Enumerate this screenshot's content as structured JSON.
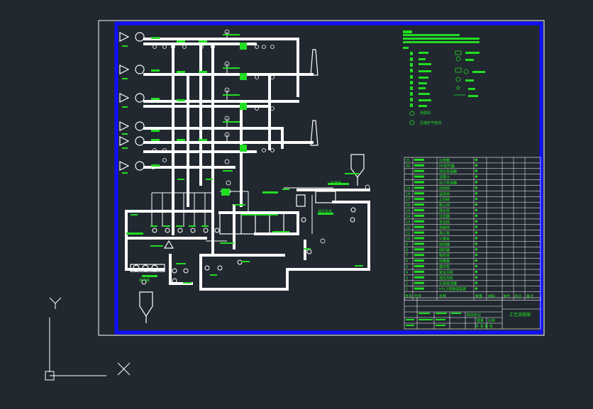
{
  "colors": {
    "background": "#212830",
    "sheet_border": "#ffffff",
    "frame": "#1010ff",
    "pipe": "#ffffff",
    "annotation": "#22dd22",
    "table_line": "#ffffff"
  },
  "icons": {
    "ucs_y_axis": "Y",
    "ucs_x_axis": "X"
  },
  "legend": {
    "item_a": "电源线",
    "item_b": "压缩空气管线"
  },
  "equipment_labels": {
    "silo": "除雾器",
    "separator": "液压系统",
    "tank": "缓冲罐"
  },
  "parts_table": {
    "header": [
      "序号",
      "代号",
      "名称",
      "数量",
      "材料",
      "单件",
      "总计",
      "备注"
    ],
    "rows": [
      {
        "no": "21",
        "code": "",
        "name": "仪表箱"
      },
      {
        "no": "20",
        "code": "",
        "name": "PH调节器"
      },
      {
        "no": "",
        "code": "",
        "name": "液位变送器"
      },
      {
        "no": "",
        "code": "",
        "name": "流量计"
      },
      {
        "no": "",
        "code": "",
        "name": "压力变送器"
      },
      {
        "no": "19",
        "code": "",
        "name": "控制阀"
      },
      {
        "no": "18",
        "code": "",
        "name": "溢流阀"
      },
      {
        "no": "17",
        "code": "",
        "name": "止回阀"
      },
      {
        "no": "16",
        "code": "",
        "name": "截止阀"
      },
      {
        "no": "15",
        "code": "",
        "name": "疏水阀"
      },
      {
        "no": "14",
        "code": "",
        "name": "过滤器"
      },
      {
        "no": "13",
        "code": "",
        "name": "安全阀"
      },
      {
        "no": "12",
        "code": "",
        "name": "电磁阀"
      },
      {
        "no": "11",
        "code": "",
        "name": "离心泵"
      },
      {
        "no": "10",
        "code": "",
        "name": "计量泵"
      },
      {
        "no": "9",
        "code": "",
        "name": "搅拌器"
      },
      {
        "no": "8",
        "code": "",
        "name": "储药罐"
      },
      {
        "no": "7",
        "code": "",
        "name": "吸收塔"
      },
      {
        "no": "6",
        "code": "",
        "name": "除雾器"
      },
      {
        "no": "5",
        "code": "",
        "name": "循环泵"
      },
      {
        "no": "4",
        "code": "",
        "name": "氧化风机"
      },
      {
        "no": "3",
        "code": "",
        "name": "增压风机"
      },
      {
        "no": "2",
        "code": "",
        "name": "石膏旋流器"
      },
      {
        "no": "1",
        "code": "",
        "name": "HYJ-1型脱硫装置"
      }
    ]
  },
  "title_block": {
    "drawing_name": "工艺流程图",
    "col_a": "阶段标记",
    "col_b": "重量",
    "col_c": "比例",
    "sheet": "共  张  第  张"
  }
}
